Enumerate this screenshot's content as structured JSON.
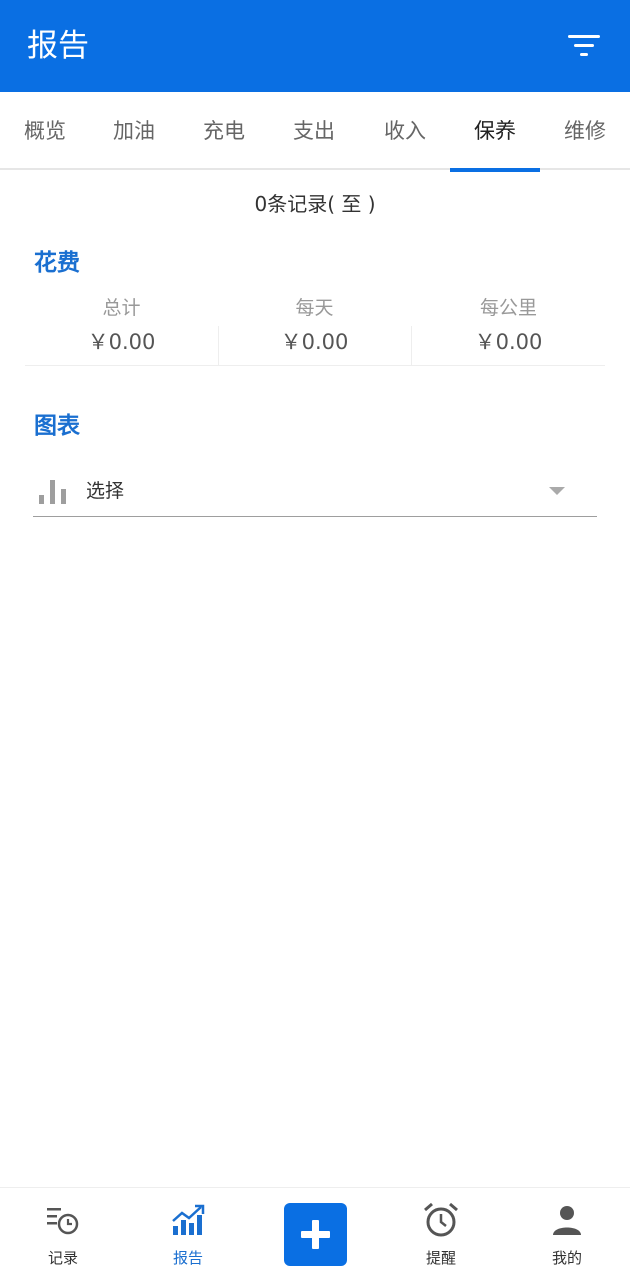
{
  "header": {
    "title": "报告",
    "filter_icon": "filter-icon"
  },
  "tabs": [
    {
      "label": "概览",
      "active": false
    },
    {
      "label": "加油",
      "active": false
    },
    {
      "label": "充电",
      "active": false
    },
    {
      "label": "支出",
      "active": false
    },
    {
      "label": "收入",
      "active": false
    },
    {
      "label": "保养",
      "active": true
    },
    {
      "label": "维修",
      "active": false
    }
  ],
  "records_text": "0条记录( 至 )",
  "cost": {
    "title": "花费",
    "stats": [
      {
        "label": "总计",
        "value": "￥0.00"
      },
      {
        "label": "每天",
        "value": "￥0.00"
      },
      {
        "label": "每公里",
        "value": "￥0.00"
      }
    ]
  },
  "chart_section": {
    "title": "图表",
    "select_label": "选择",
    "select_icon": "bar-chart-icon",
    "dropdown_icon": "caret-down-icon"
  },
  "bottom_nav": [
    {
      "label": "记录",
      "icon": "records-clock-icon",
      "active": false
    },
    {
      "label": "报告",
      "icon": "report-chart-icon",
      "active": true
    },
    {
      "label": "",
      "icon": "plus-icon",
      "active": false
    },
    {
      "label": "提醒",
      "icon": "alarm-clock-icon",
      "active": false
    },
    {
      "label": "我的",
      "icon": "user-icon",
      "active": false
    }
  ],
  "colors": {
    "primary": "#0a6fe3",
    "section_title": "#1a6fd0"
  }
}
